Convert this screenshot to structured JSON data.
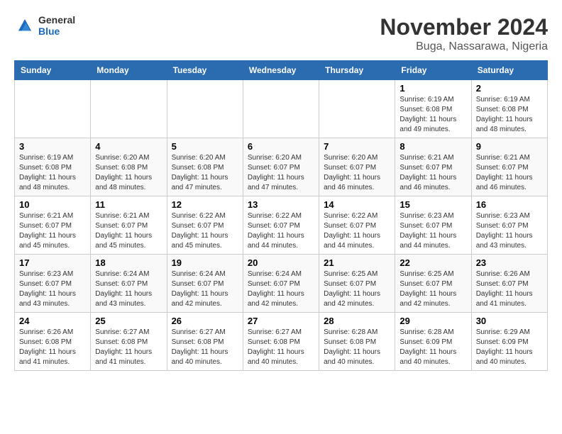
{
  "header": {
    "logo_general": "General",
    "logo_blue": "Blue",
    "main_title": "November 2024",
    "subtitle": "Buga, Nassarawa, Nigeria"
  },
  "calendar": {
    "days_of_week": [
      "Sunday",
      "Monday",
      "Tuesday",
      "Wednesday",
      "Thursday",
      "Friday",
      "Saturday"
    ],
    "weeks": [
      [
        {
          "day": "",
          "info": ""
        },
        {
          "day": "",
          "info": ""
        },
        {
          "day": "",
          "info": ""
        },
        {
          "day": "",
          "info": ""
        },
        {
          "day": "",
          "info": ""
        },
        {
          "day": "1",
          "info": "Sunrise: 6:19 AM\nSunset: 6:08 PM\nDaylight: 11 hours and 49 minutes."
        },
        {
          "day": "2",
          "info": "Sunrise: 6:19 AM\nSunset: 6:08 PM\nDaylight: 11 hours and 48 minutes."
        }
      ],
      [
        {
          "day": "3",
          "info": "Sunrise: 6:19 AM\nSunset: 6:08 PM\nDaylight: 11 hours and 48 minutes."
        },
        {
          "day": "4",
          "info": "Sunrise: 6:20 AM\nSunset: 6:08 PM\nDaylight: 11 hours and 48 minutes."
        },
        {
          "day": "5",
          "info": "Sunrise: 6:20 AM\nSunset: 6:08 PM\nDaylight: 11 hours and 47 minutes."
        },
        {
          "day": "6",
          "info": "Sunrise: 6:20 AM\nSunset: 6:07 PM\nDaylight: 11 hours and 47 minutes."
        },
        {
          "day": "7",
          "info": "Sunrise: 6:20 AM\nSunset: 6:07 PM\nDaylight: 11 hours and 46 minutes."
        },
        {
          "day": "8",
          "info": "Sunrise: 6:21 AM\nSunset: 6:07 PM\nDaylight: 11 hours and 46 minutes."
        },
        {
          "day": "9",
          "info": "Sunrise: 6:21 AM\nSunset: 6:07 PM\nDaylight: 11 hours and 46 minutes."
        }
      ],
      [
        {
          "day": "10",
          "info": "Sunrise: 6:21 AM\nSunset: 6:07 PM\nDaylight: 11 hours and 45 minutes."
        },
        {
          "day": "11",
          "info": "Sunrise: 6:21 AM\nSunset: 6:07 PM\nDaylight: 11 hours and 45 minutes."
        },
        {
          "day": "12",
          "info": "Sunrise: 6:22 AM\nSunset: 6:07 PM\nDaylight: 11 hours and 45 minutes."
        },
        {
          "day": "13",
          "info": "Sunrise: 6:22 AM\nSunset: 6:07 PM\nDaylight: 11 hours and 44 minutes."
        },
        {
          "day": "14",
          "info": "Sunrise: 6:22 AM\nSunset: 6:07 PM\nDaylight: 11 hours and 44 minutes."
        },
        {
          "day": "15",
          "info": "Sunrise: 6:23 AM\nSunset: 6:07 PM\nDaylight: 11 hours and 44 minutes."
        },
        {
          "day": "16",
          "info": "Sunrise: 6:23 AM\nSunset: 6:07 PM\nDaylight: 11 hours and 43 minutes."
        }
      ],
      [
        {
          "day": "17",
          "info": "Sunrise: 6:23 AM\nSunset: 6:07 PM\nDaylight: 11 hours and 43 minutes."
        },
        {
          "day": "18",
          "info": "Sunrise: 6:24 AM\nSunset: 6:07 PM\nDaylight: 11 hours and 43 minutes."
        },
        {
          "day": "19",
          "info": "Sunrise: 6:24 AM\nSunset: 6:07 PM\nDaylight: 11 hours and 42 minutes."
        },
        {
          "day": "20",
          "info": "Sunrise: 6:24 AM\nSunset: 6:07 PM\nDaylight: 11 hours and 42 minutes."
        },
        {
          "day": "21",
          "info": "Sunrise: 6:25 AM\nSunset: 6:07 PM\nDaylight: 11 hours and 42 minutes."
        },
        {
          "day": "22",
          "info": "Sunrise: 6:25 AM\nSunset: 6:07 PM\nDaylight: 11 hours and 42 minutes."
        },
        {
          "day": "23",
          "info": "Sunrise: 6:26 AM\nSunset: 6:07 PM\nDaylight: 11 hours and 41 minutes."
        }
      ],
      [
        {
          "day": "24",
          "info": "Sunrise: 6:26 AM\nSunset: 6:08 PM\nDaylight: 11 hours and 41 minutes."
        },
        {
          "day": "25",
          "info": "Sunrise: 6:27 AM\nSunset: 6:08 PM\nDaylight: 11 hours and 41 minutes."
        },
        {
          "day": "26",
          "info": "Sunrise: 6:27 AM\nSunset: 6:08 PM\nDaylight: 11 hours and 40 minutes."
        },
        {
          "day": "27",
          "info": "Sunrise: 6:27 AM\nSunset: 6:08 PM\nDaylight: 11 hours and 40 minutes."
        },
        {
          "day": "28",
          "info": "Sunrise: 6:28 AM\nSunset: 6:08 PM\nDaylight: 11 hours and 40 minutes."
        },
        {
          "day": "29",
          "info": "Sunrise: 6:28 AM\nSunset: 6:09 PM\nDaylight: 11 hours and 40 minutes."
        },
        {
          "day": "30",
          "info": "Sunrise: 6:29 AM\nSunset: 6:09 PM\nDaylight: 11 hours and 40 minutes."
        }
      ]
    ]
  }
}
